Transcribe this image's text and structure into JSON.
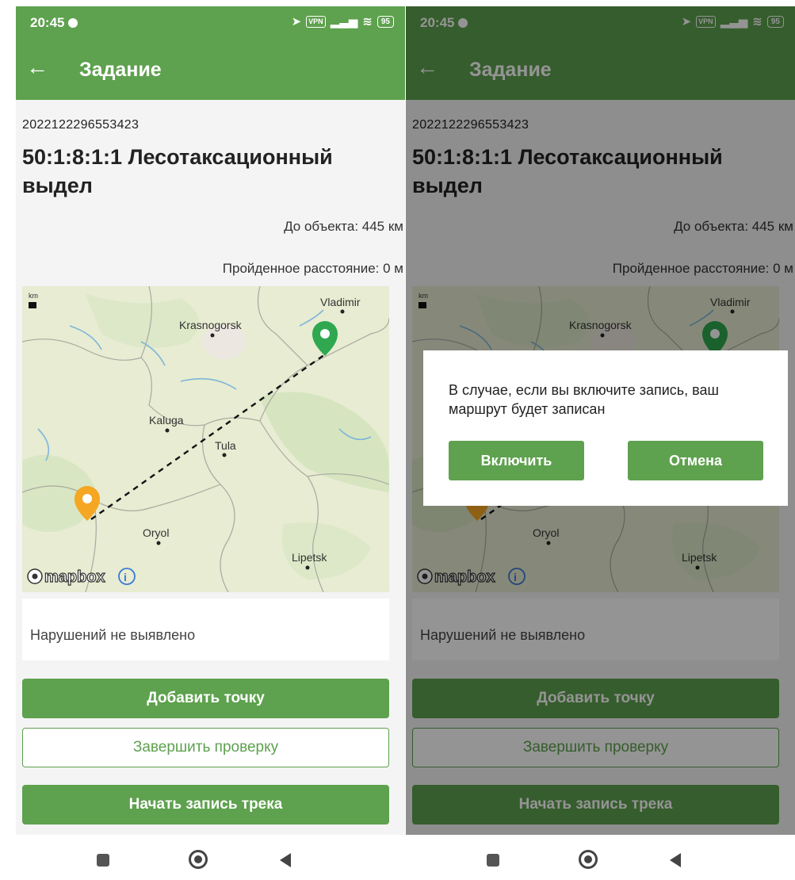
{
  "status_bar": {
    "time": "20:45",
    "vpn": "VPN",
    "battery": "95"
  },
  "app_bar": {
    "title": "Задание",
    "back_icon": "arrow-left-icon"
  },
  "task": {
    "id": "2022122296553423",
    "title": "50:1:8:1:1 Лесотаксационный выдел",
    "distance_to_object": "До объекта: 445 км",
    "travelled_distance": "Пройденное расстояние: 0 м"
  },
  "map": {
    "scale_label": "km",
    "cities": [
      "Vladimir",
      "Krasnogorsk",
      "Kaluga",
      "Tula",
      "Oryol",
      "Lipetsk"
    ],
    "attribution": "mapbox",
    "start_marker_color": "#f5a623",
    "end_marker_color": "#2fa84f"
  },
  "violations": {
    "text": "Нарушений не выявлено"
  },
  "buttons": {
    "add_point": "Добавить точку",
    "finish_check": "Завершить проверку",
    "start_track": "Начать запись трека"
  },
  "dialog": {
    "message": "В случае, если вы включите запись, ваш маршрут будет записан",
    "confirm": "Включить",
    "cancel": "Отмена"
  },
  "theme": {
    "primary": "#5ea14e"
  }
}
